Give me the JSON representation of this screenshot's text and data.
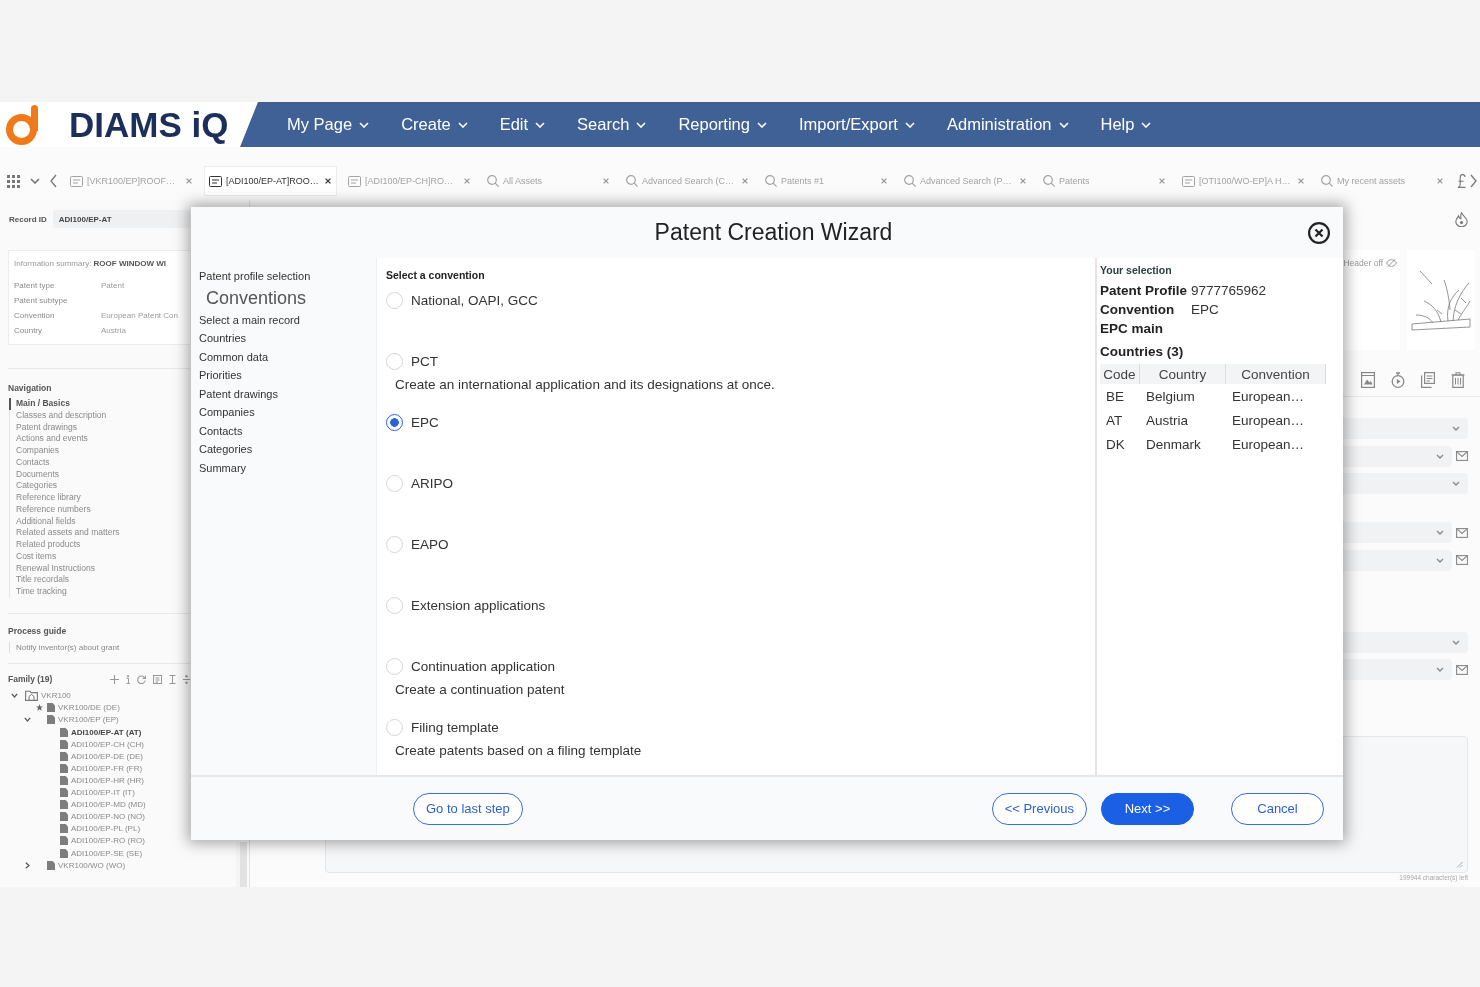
{
  "header": {
    "logo_text": "DIAMS iQ",
    "menu": [
      "My Page",
      "Create",
      "Edit",
      "Search",
      "Reporting",
      "Import/Export",
      "Administration",
      "Help"
    ]
  },
  "tabs_bar": {
    "tabs": [
      {
        "label": "[VKR100/EP]ROOF…",
        "kind": "record",
        "selected": false
      },
      {
        "label": "[ADI100/EP-AT]ROO…",
        "kind": "record",
        "selected": true
      },
      {
        "label": "[ADI100/EP-CH]RO…",
        "kind": "record",
        "selected": false
      },
      {
        "label": "All Assets",
        "kind": "search",
        "selected": false
      },
      {
        "label": "Advanced Search (C…",
        "kind": "search",
        "selected": false
      },
      {
        "label": "Patents #1",
        "kind": "search",
        "selected": false
      },
      {
        "label": "Advanced Search (P…",
        "kind": "search",
        "selected": false
      },
      {
        "label": "Patents",
        "kind": "search",
        "selected": false
      },
      {
        "label": "[OTI100/WO-EP]A H…",
        "kind": "record",
        "selected": false
      },
      {
        "label": "My recent assets",
        "kind": "search",
        "selected": false
      }
    ]
  },
  "record_panel": {
    "record_id_label": "Record ID",
    "record_id": "ADI100/EP-AT",
    "summary": {
      "title": "Information summary: **ROOF WINDOW WI**",
      "fields": [
        {
          "label": "Patent type",
          "value": "Patent"
        },
        {
          "label": "Patent subtype"
        },
        {
          "label": "Convention",
          "value": "European Patent Con"
        },
        {
          "label": "Country",
          "value": "Austria"
        }
      ]
    },
    "navigation": {
      "title": "Navigation",
      "items": [
        {
          "label": "Main / Basics",
          "selected": true
        },
        {
          "label": "Classes and description",
          "selected": false
        },
        {
          "label": "Patent drawings",
          "selected": false
        },
        {
          "label": "Actions and events",
          "selected": false
        },
        {
          "label": "Companies",
          "selected": false
        },
        {
          "label": "Contacts",
          "selected": false
        },
        {
          "label": "Documents",
          "selected": false
        },
        {
          "label": "Categories",
          "selected": false
        },
        {
          "label": "Reference library",
          "selected": false
        },
        {
          "label": "Reference numbers",
          "selected": false
        },
        {
          "label": "Additional fields",
          "selected": false
        },
        {
          "label": "Related assets and matters",
          "selected": false
        },
        {
          "label": "Related products",
          "selected": false
        },
        {
          "label": "Cost items",
          "selected": false
        },
        {
          "label": "Renewal Instructions",
          "selected": false
        },
        {
          "label": "Title recordals",
          "selected": false
        },
        {
          "label": "Time tracking",
          "selected": false
        }
      ]
    },
    "process_guide": {
      "title": "Process guide",
      "items": [
        "Notify inventor(s) about grant"
      ]
    },
    "family": {
      "title": "Family (19)",
      "tree": [
        {
          "label": "VKR100",
          "kind": "family",
          "expanded": true,
          "starred": false,
          "selected": false,
          "children": [
            {
              "label": "VKR100/DE (DE)",
              "kind": "record",
              "starred": true,
              "selected": false
            },
            {
              "label": "VKR100/EP (EP)",
              "kind": "record",
              "expanded": true,
              "starred": false,
              "selected": false,
              "children": [
                {
                  "label": "ADI100/EP-AT (AT)",
                  "kind": "record",
                  "starred": false,
                  "selected": true
                },
                {
                  "label": "ADI100/EP-CH (CH)",
                  "kind": "record",
                  "starred": false,
                  "selected": false
                },
                {
                  "label": "ADI100/EP-DE (DE)",
                  "kind": "record",
                  "starred": false,
                  "selected": false
                },
                {
                  "label": "ADI100/EP-FR (FR)",
                  "kind": "record",
                  "starred": false,
                  "selected": false
                },
                {
                  "label": "ADI100/EP-HR (HR)",
                  "kind": "record",
                  "starred": false,
                  "selected": false
                },
                {
                  "label": "ADI100/EP-IT (IT)",
                  "kind": "record",
                  "starred": false,
                  "selected": false
                },
                {
                  "label": "ADI100/EP-MD (MD)",
                  "kind": "record",
                  "starred": false,
                  "selected": false
                },
                {
                  "label": "ADI100/EP-NO (NO)",
                  "kind": "record",
                  "starred": false,
                  "selected": false
                },
                {
                  "label": "ADI100/EP-PL (PL)",
                  "kind": "record",
                  "starred": false,
                  "selected": false
                },
                {
                  "label": "ADI100/EP-RO (RO)",
                  "kind": "record",
                  "starred": false,
                  "selected": false
                },
                {
                  "label": "ADI100/EP-SE (SE)",
                  "kind": "record",
                  "starred": false,
                  "selected": false
                }
              ]
            },
            {
              "label": "VKR100/WO (WO)",
              "kind": "record",
              "expanded": false,
              "starred": false,
              "selected": false
            }
          ]
        }
      ]
    }
  },
  "detail_panel": {
    "header_toggle": "Header off",
    "field_groups": [
      {
        "fields": [
          {
            "kind": "dropdown"
          },
          {
            "kind": "dropdown_mail"
          },
          {
            "kind": "dropdown"
          }
        ]
      },
      {
        "fields": [
          {
            "kind": "dropdown_mail"
          },
          {
            "kind": "dropdown_mail"
          }
        ]
      },
      {
        "fields": [
          {
            "kind": "dropdown"
          },
          {
            "kind": "dropdown_mail"
          }
        ]
      }
    ],
    "text_area": {
      "counter": "199944 character(s) left"
    }
  },
  "wizard": {
    "title": "Patent Creation Wizard",
    "steps": [
      {
        "label": "Patent profile selection",
        "selected": false
      },
      {
        "label": "Conventions",
        "selected": true
      },
      {
        "label": "Select a main record",
        "selected": false
      },
      {
        "label": "Countries",
        "selected": false
      },
      {
        "label": "Common data",
        "selected": false
      },
      {
        "label": "Priorities",
        "selected": false
      },
      {
        "label": "Patent drawings",
        "selected": false
      },
      {
        "label": "Companies",
        "selected": false
      },
      {
        "label": "Contacts",
        "selected": false
      },
      {
        "label": "Categories",
        "selected": false
      },
      {
        "label": "Summary",
        "selected": false
      }
    ],
    "prompt": "Select a convention",
    "conventions": [
      {
        "label": "National, OAPI, GCC",
        "selected": false
      },
      {
        "label": "PCT",
        "description": "Create an international application and its designations at once.",
        "selected": false
      },
      {
        "label": "EPC",
        "selected": true
      },
      {
        "label": "ARIPO",
        "selected": false
      },
      {
        "label": "EAPO",
        "selected": false
      },
      {
        "label": "Extension applications",
        "selected": false
      },
      {
        "label": "Continuation application",
        "description": "Create a continuation patent",
        "selected": false
      },
      {
        "label": "Filing template",
        "description": "Create patents based on a filing template",
        "selected": false
      }
    ],
    "selection": {
      "title": "Your selection",
      "rows": [
        {
          "label": "Patent Profile",
          "value": "9777765962"
        },
        {
          "label": "Convention",
          "value": "EPC"
        },
        {
          "label": "EPC main"
        }
      ],
      "countries_title": "Countries (3)",
      "columns": [
        "Code",
        "Country",
        "Convention"
      ],
      "countries": [
        {
          "code": "BE",
          "country": "Belgium",
          "convention": "European…"
        },
        {
          "code": "AT",
          "country": "Austria",
          "convention": "European…"
        },
        {
          "code": "DK",
          "country": "Denmark",
          "convention": "European…"
        }
      ]
    },
    "footer": {
      "left_buttons": [
        {
          "label": "Go to last step",
          "kind": "outline"
        }
      ],
      "right_buttons": [
        {
          "label": "<< Previous",
          "kind": "outline"
        },
        {
          "label": "Next >>",
          "kind": "primary"
        },
        {
          "label": "Cancel",
          "kind": "cancel"
        }
      ]
    }
  }
}
